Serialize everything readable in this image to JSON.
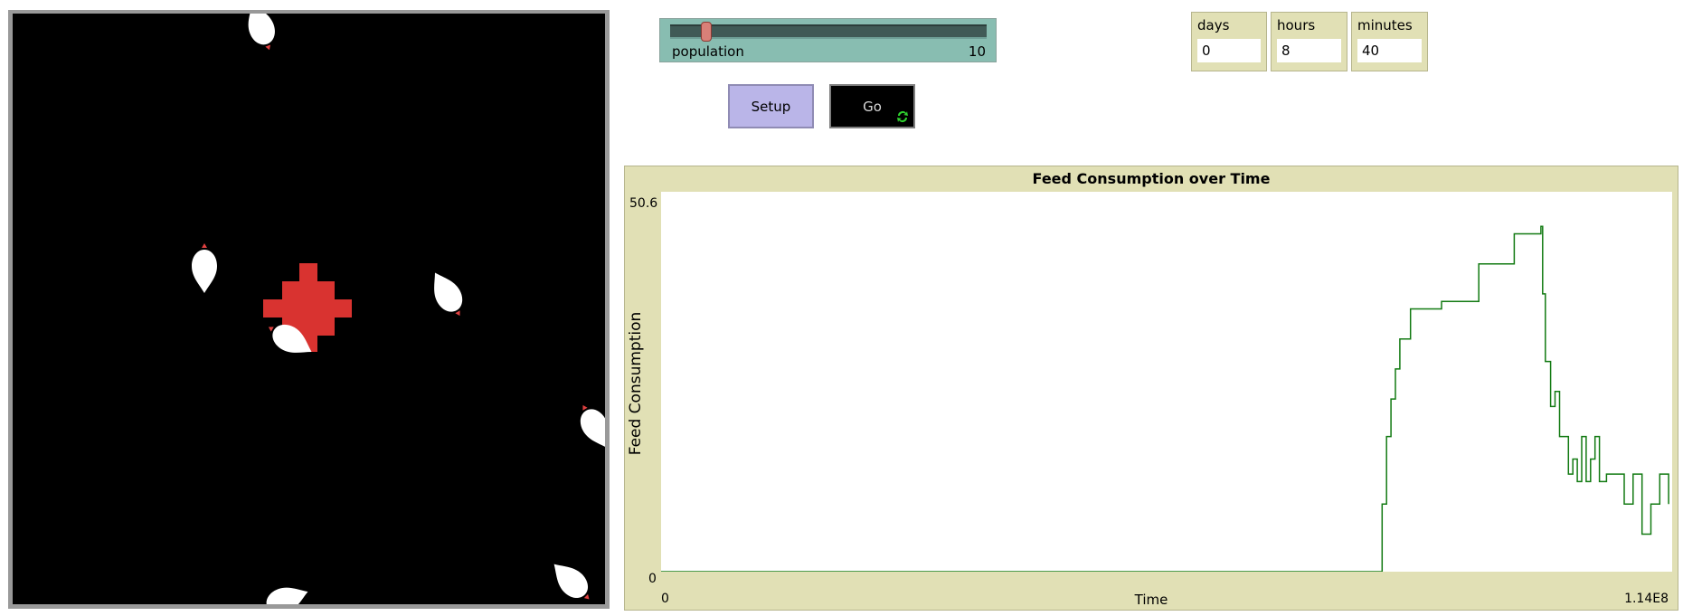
{
  "slider": {
    "label": "population",
    "value": "10",
    "min": 0,
    "max": 100,
    "current": 10
  },
  "buttons": {
    "setup_label": "Setup",
    "go_label": "Go"
  },
  "monitors": [
    {
      "label": "days",
      "value": "0"
    },
    {
      "label": "hours",
      "value": "8"
    },
    {
      "label": "minutes",
      "value": "40"
    }
  ],
  "plot": {
    "title": "Feed Consumption over Time",
    "xlabel": "Time",
    "ylabel": "Feed Consumption",
    "xmin_label": "0",
    "xmax_label": "1.14E8",
    "ymin_label": "0",
    "ymax_label": "50.6"
  },
  "colors": {
    "plot_line": "#127a12",
    "patch_feed": "#d93330",
    "turtle": "#ffffff"
  },
  "icons": {
    "forever": "forever-arrows-icon",
    "chicken": "chicken-icon"
  },
  "chart_data": {
    "type": "line",
    "title": "Feed Consumption over Time",
    "xlabel": "Time",
    "ylabel": "Feed Consumption",
    "xlim": [
      0,
      114000000
    ],
    "ylim": [
      0,
      50.6
    ],
    "series": [
      {
        "x": [
          0,
          81000000,
          81300000,
          81800000,
          82300000,
          82800000,
          83300000,
          84500000,
          88000000,
          92200000,
          96200000,
          99200000,
          99400000,
          99700000,
          100300000,
          100800000,
          101300000,
          101800000,
          102300000,
          102800000,
          103300000,
          103800000,
          104300000,
          104800000,
          105300000,
          105800000,
          106600000,
          107600000,
          108600000,
          109600000,
          110600000,
          111600000,
          112600000,
          113600000
        ],
        "y": [
          0,
          0,
          9,
          18,
          23,
          27,
          31,
          35,
          36,
          41,
          45,
          46,
          37,
          28,
          22,
          24,
          18,
          18,
          13,
          15,
          12,
          18,
          12,
          15,
          18,
          12,
          13,
          13,
          9,
          13,
          5,
          9,
          13,
          9
        ]
      }
    ]
  }
}
